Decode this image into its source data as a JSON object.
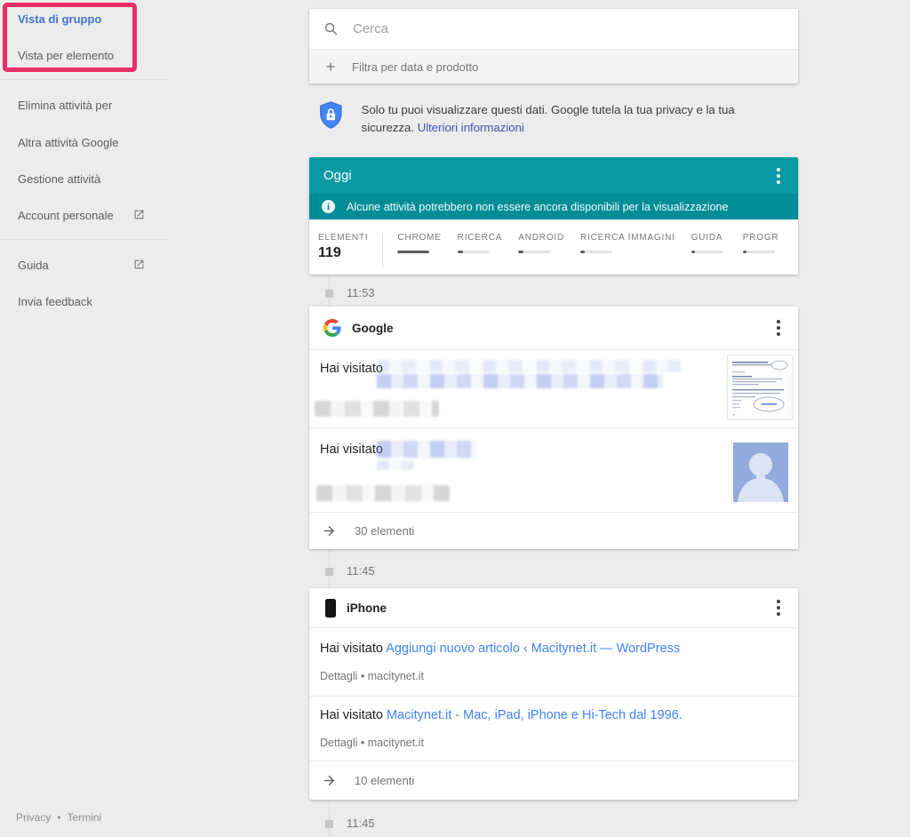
{
  "colors": {
    "teal_header": "#0899a3",
    "teal_banner": "#008d96",
    "annotation_pink": "#ea2e66",
    "link_blue": "#4184f3",
    "active_view_blue": "#4173c9"
  },
  "sidebar": {
    "view_group": "Vista di gruppo",
    "view_item": "Vista per elemento",
    "delete_activity": "Elimina attività per",
    "other_activity": "Altra attività Google",
    "manage_activity": "Gestione attività",
    "personal_account": "Account personale",
    "help": "Guida",
    "send_feedback": "Invia feedback",
    "privacy": "Privacy",
    "footer_separator": "•",
    "terms": "Termini"
  },
  "search": {
    "placeholder": "Cerca",
    "filter_label": "Filtra per data e prodotto"
  },
  "privacy_notice": {
    "text": "Solo tu puoi visualizzare questi dati. Google tutela la tua privacy e la tua sicurezza. ",
    "link_label": "Ulteriori informazioni"
  },
  "today": {
    "title": "Oggi",
    "banner_text": "Alcune attività potrebbero non essere ancora disponibili per la visualizzazione",
    "stats": {
      "elements_label": "ELEMENTI",
      "elements_count": "119",
      "products": [
        {
          "label": "CHROME",
          "bar_style": "width:100%"
        },
        {
          "label": "RICERCA",
          "bar_style": "width:18%"
        },
        {
          "label": "ANDROID",
          "bar_style": "width:15%"
        },
        {
          "label": "RICERCA IMMAGINI",
          "bar_style": "width:13%"
        },
        {
          "label": "GUIDA",
          "bar_style": "width:13%"
        },
        {
          "label": "PROGR",
          "bar_style": "width:13%"
        }
      ]
    }
  },
  "timeline": {
    "marker1": "11:53",
    "marker2": "11:45",
    "marker3": "11:45"
  },
  "google_card": {
    "title": "Google",
    "visit_prefix": "Hai visitato",
    "footer_label": "30 elementi"
  },
  "iphone_card": {
    "title": "iPhone",
    "visit_prefix": "Hai visitato",
    "entry1_link": "Aggiungi nuovo articolo ‹ Macitynet.it — WordPress",
    "entry1_details": "Dettagli • macitynet.it",
    "entry2_link": "Macitynet.it - Mac, iPad, iPhone e Hi-Tech dal 1996.",
    "entry2_details": "Dettagli • macitynet.it",
    "footer_label": "10 elementi"
  }
}
